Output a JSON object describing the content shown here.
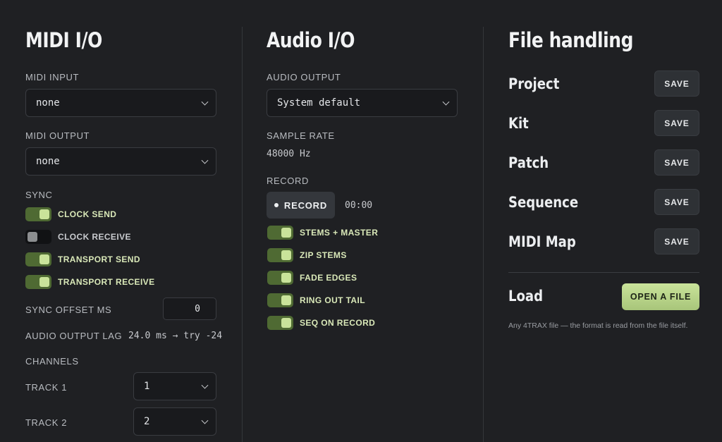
{
  "midi": {
    "heading": "MIDI I/O",
    "midi_input_label": "MIDI INPUT",
    "midi_input_value": "none",
    "midi_output_label": "MIDI OUTPUT",
    "midi_output_value": "none",
    "sync_label": "SYNC",
    "sync_toggles": [
      {
        "label": "CLOCK SEND",
        "on": true
      },
      {
        "label": "CLOCK RECEIVE",
        "on": false
      },
      {
        "label": "TRANSPORT SEND",
        "on": true
      },
      {
        "label": "TRANSPORT RECEIVE",
        "on": true
      }
    ],
    "sync_offset_label": "SYNC OFFSET MS",
    "sync_offset_value": "0",
    "audio_output_lag_label": "AUDIO OUTPUT LAG",
    "audio_output_lag_value": "24.0 ms → try -24",
    "channels_label": "CHANNELS",
    "tracks": [
      {
        "label": "TRACK 1",
        "value": "1"
      },
      {
        "label": "TRACK 2",
        "value": "2"
      }
    ]
  },
  "audio": {
    "heading": "Audio I/O",
    "audio_output_label": "AUDIO OUTPUT",
    "audio_output_value": "System default",
    "sample_rate_label": "SAMPLE RATE",
    "sample_rate_value": "48000 Hz",
    "record_label": "RECORD",
    "record_button": "RECORD",
    "record_time": "00:00",
    "record_toggles": [
      {
        "label": "STEMS + MASTER",
        "on": true
      },
      {
        "label": "ZIP STEMS",
        "on": true
      },
      {
        "label": "FADE EDGES",
        "on": true
      },
      {
        "label": "RING OUT TAIL",
        "on": true
      },
      {
        "label": "SEQ ON RECORD",
        "on": true
      }
    ]
  },
  "files": {
    "heading": "File handling",
    "items": [
      {
        "name": "Project",
        "button": "SAVE"
      },
      {
        "name": "Kit",
        "button": "SAVE"
      },
      {
        "name": "Patch",
        "button": "SAVE"
      },
      {
        "name": "Sequence",
        "button": "SAVE"
      },
      {
        "name": "MIDI Map",
        "button": "SAVE"
      }
    ],
    "load_label": "Load",
    "open_button": "OPEN A FILE",
    "hint": "Any 4TRAX file — the format is read from the file itself."
  },
  "colors": {
    "background": "#1f2023",
    "accent": "#c9e39a",
    "toggle_on": "#4f6a33"
  }
}
